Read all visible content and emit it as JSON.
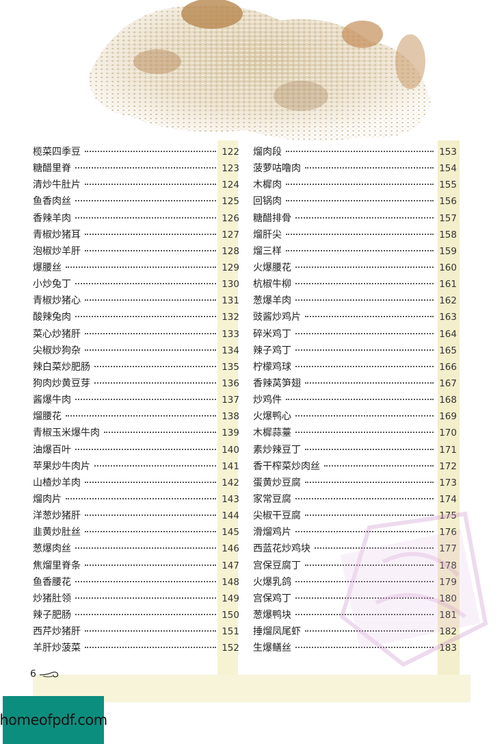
{
  "toc": {
    "left": [
      {
        "title": "榄菜四季豆",
        "page": "122"
      },
      {
        "title": "糖醋里脊",
        "page": "123"
      },
      {
        "title": "清炒牛肚片",
        "page": "124"
      },
      {
        "title": "鱼香肉丝",
        "page": "125"
      },
      {
        "title": "香辣羊肉",
        "page": "126"
      },
      {
        "title": "青椒炒猪耳",
        "page": "127"
      },
      {
        "title": "泡椒炒羊肝",
        "page": "128"
      },
      {
        "title": "爆腰丝",
        "page": "129"
      },
      {
        "title": "小炒兔丁",
        "page": "130"
      },
      {
        "title": "青椒炒猪心",
        "page": "131"
      },
      {
        "title": "酸辣兔肉",
        "page": "132"
      },
      {
        "title": "菜心炒猪肝",
        "page": "133"
      },
      {
        "title": "尖椒炒狗杂",
        "page": "134"
      },
      {
        "title": "辣白菜炒肥肠",
        "page": "135"
      },
      {
        "title": "狗肉炒黄豆芽",
        "page": "136"
      },
      {
        "title": "酱爆牛肉",
        "page": "137"
      },
      {
        "title": "熘腰花",
        "page": "138"
      },
      {
        "title": "青椒玉米爆牛肉",
        "page": "139"
      },
      {
        "title": "油爆百叶",
        "page": "140"
      },
      {
        "title": "苹果炒牛肉片",
        "page": "141"
      },
      {
        "title": "山楂炒羊肉",
        "page": "142"
      },
      {
        "title": "熘肉片",
        "page": "143"
      },
      {
        "title": "洋葱炒猪肝",
        "page": "144"
      },
      {
        "title": "韭黄炒肚丝",
        "page": "145"
      },
      {
        "title": "葱爆肉丝",
        "page": "146"
      },
      {
        "title": "焦熘里脊条",
        "page": "147"
      },
      {
        "title": "鱼香腰花",
        "page": "148"
      },
      {
        "title": "炒猪肚领",
        "page": "149"
      },
      {
        "title": "辣子肥肠",
        "page": "150"
      },
      {
        "title": "西芹炒猪肝",
        "page": "151"
      },
      {
        "title": "羊肝炒菠菜",
        "page": "152"
      }
    ],
    "right": [
      {
        "title": "熘肉段",
        "page": "153"
      },
      {
        "title": "菠萝咕噜肉",
        "page": "154"
      },
      {
        "title": "木樨肉",
        "page": "155"
      },
      {
        "title": "回锅肉",
        "page": "156"
      },
      {
        "title": "糖醋排骨",
        "page": "157"
      },
      {
        "title": "熘肝尖",
        "page": "158"
      },
      {
        "title": "熘三样",
        "page": "159"
      },
      {
        "title": "火爆腰花",
        "page": "160"
      },
      {
        "title": "杭椒牛柳",
        "page": "161"
      },
      {
        "title": "葱爆羊肉",
        "page": "162"
      },
      {
        "title": "豉酱炒鸡片",
        "page": "163"
      },
      {
        "title": "碎米鸡丁",
        "page": "164"
      },
      {
        "title": "辣子鸡丁",
        "page": "165"
      },
      {
        "title": "柠檬鸡球",
        "page": "166"
      },
      {
        "title": "香辣莴笋翅",
        "page": "167"
      },
      {
        "title": "炒鸡件",
        "page": "168"
      },
      {
        "title": "火爆鸭心",
        "page": "169"
      },
      {
        "title": "木樨蒜薹",
        "page": "170"
      },
      {
        "title": "素炒辣豆丁",
        "page": "171"
      },
      {
        "title": "香干榨菜炒肉丝",
        "page": "172"
      },
      {
        "title": "蛋黄炒豆腐",
        "page": "173"
      },
      {
        "title": "家常豆腐",
        "page": "174"
      },
      {
        "title": "尖椒干豆腐",
        "page": "175"
      },
      {
        "title": "滑熘鸡片",
        "page": "176"
      },
      {
        "title": "西蓝花炒鸡块",
        "page": "177"
      },
      {
        "title": "宫保豆腐丁",
        "page": "178"
      },
      {
        "title": "火爆乳鸽",
        "page": "179"
      },
      {
        "title": "宫保鸡丁",
        "page": "180"
      },
      {
        "title": "葱爆鸭块",
        "page": "181"
      },
      {
        "title": "捶熘凤尾虾",
        "page": "182"
      },
      {
        "title": "生爆鳝丝",
        "page": "183"
      }
    ]
  },
  "page_number": "6",
  "logo_text": "homeofpdf.com",
  "colors": {
    "band": "#f6f3d3",
    "logo_bg": "#0c8e7e",
    "watermark": "#c98cc9"
  }
}
